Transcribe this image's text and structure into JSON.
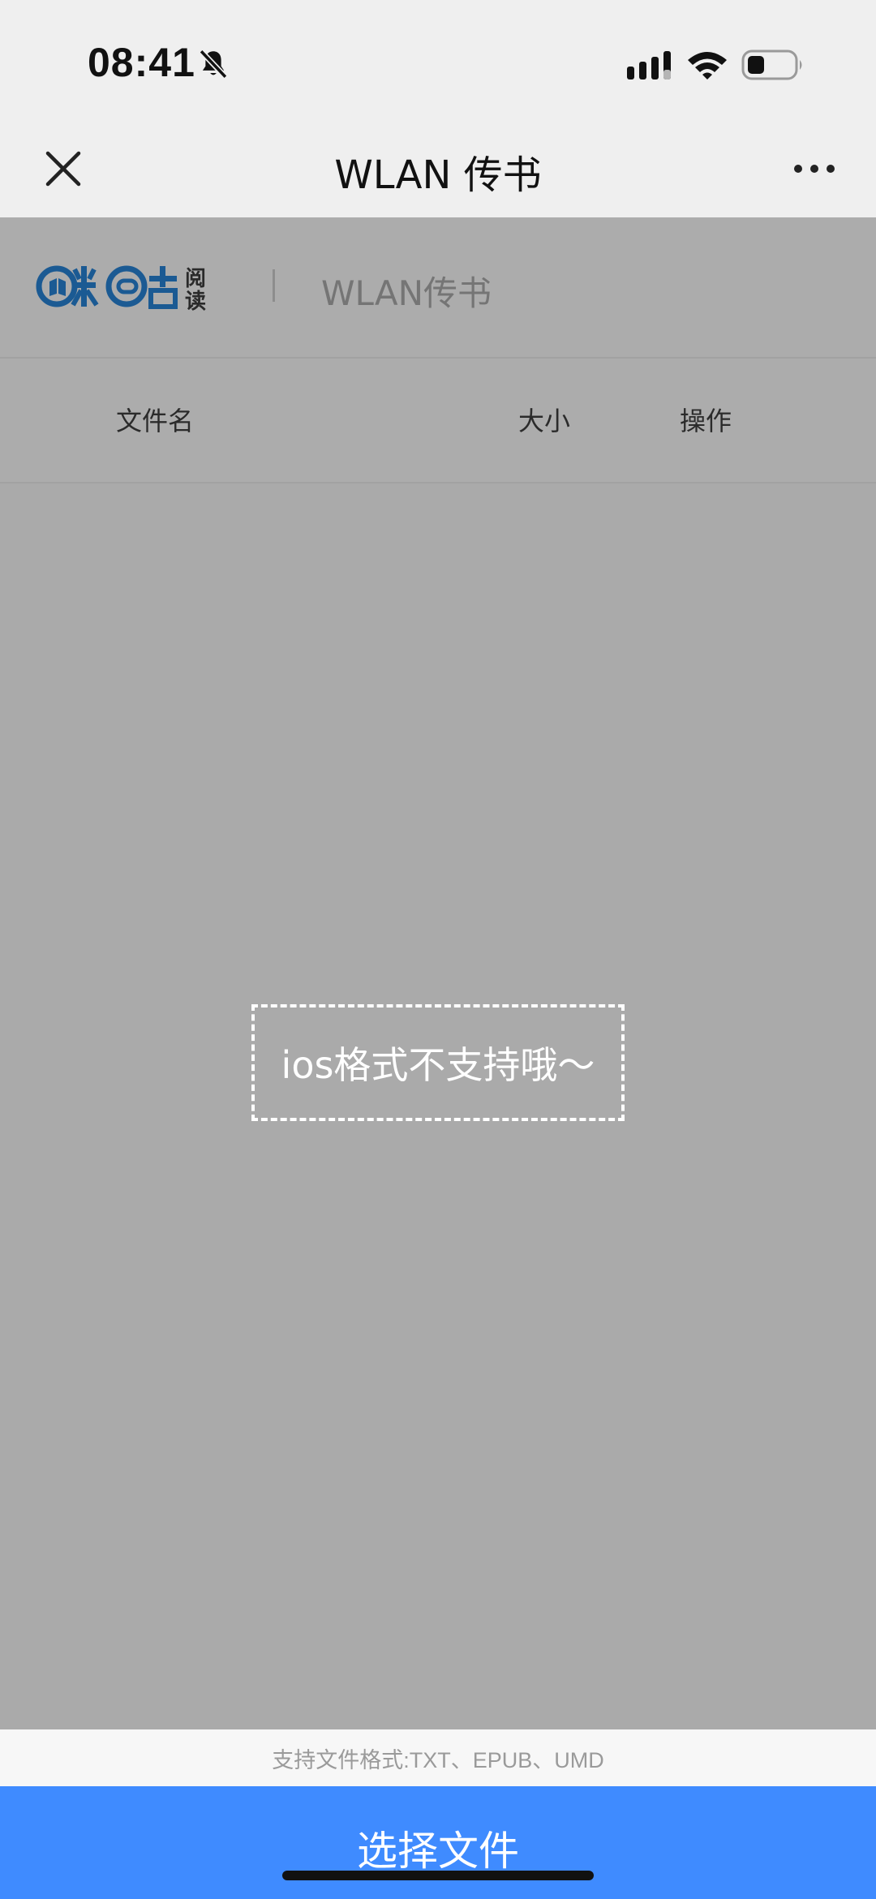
{
  "status_bar": {
    "time": "08:41",
    "icons": [
      "bell-slash-icon",
      "cellular-signal-icon",
      "wifi-icon",
      "battery-icon"
    ]
  },
  "nav": {
    "title": "WLAN 传书",
    "close_icon": "close-icon",
    "more_icon": "more-icon"
  },
  "brand": {
    "logo_text": "咪咕阅读",
    "page_title": "WLAN传书"
  },
  "table": {
    "columns": [
      "文件名",
      "大小",
      "操作"
    ],
    "rows": []
  },
  "notice": {
    "text": "ios格式不支持哦～"
  },
  "footer": {
    "supported_formats": "支持文件格式:TXT、EPUB、UMD",
    "select_button": "选择文件"
  },
  "colors": {
    "accent": "#3f8bff",
    "overlay": "#aaaaaa",
    "brand_blue": "#1b5a93",
    "bar_background": "#efefef"
  }
}
